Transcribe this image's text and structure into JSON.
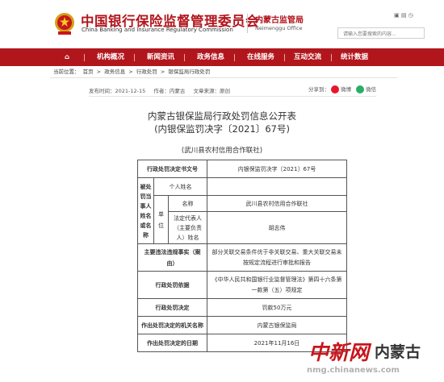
{
  "header": {
    "title_cn": "中国银行保险监督管理委员会",
    "title_en": "China Banking and Insurance Regulatory Commission",
    "branch_cn": "内蒙古监管局",
    "branch_en": "Neimenggu Office",
    "top_links": "▣ ▤ ◷",
    "search_placeholder": "请输入您要搜索的内容...",
    "search_icon": "search-icon"
  },
  "nav": {
    "items": [
      "首页",
      "机构概况",
      "新闻资讯",
      "政务信息",
      "在线服务",
      "互动交流",
      "统计数据"
    ]
  },
  "breadcrumb": {
    "label": "当前位置：",
    "items": [
      "首页",
      ">",
      "政务信息",
      ">",
      "行政处罚",
      ">",
      "银保监局行政处罚"
    ]
  },
  "meta": {
    "date": "发布时间：2021-12-15",
    "author": "作者：内蒙古",
    "source": "文章来源：原创",
    "share": [
      "分享到：",
      "微博",
      "微信"
    ]
  },
  "document": {
    "title_line1": "内蒙古银保监局行政处罚信息公开表",
    "title_line2": "(内银保监罚决字〔2021〕67号)",
    "org": "(武川县农村信用合作联社)"
  },
  "table": {
    "decision_no_label": "行政处罚决定书文号",
    "decision_no_value": "内银保监罚决字〔2021〕67号",
    "party_label": "被处罚当事人姓名或名称",
    "person_label": "个人姓名",
    "person_value": "",
    "unit_label": "单位",
    "name_label": "名称",
    "name_value": "武川县农村信用合作联社",
    "legal_rep_label": "法定代表人（主要负责人）姓名",
    "legal_rep_value": "胡志伟",
    "violation_label": "主要违法违规事实（案由）",
    "violation_value": "部分关联交易条件优于非关联交易、重大关联交易未按规定流程进行审批和报告",
    "basis_label": "行政处罚依据",
    "basis_value": "《中华人民共和国银行业监督管理法》第四十六条第一款第（五）项规定",
    "decision_label": "行政处罚决定",
    "decision_value": "罚款50万元",
    "authority_label": "作出处罚决定的机关名称",
    "authority_value": "内蒙古银保监局",
    "date_label": "作出处罚决定的日期",
    "date_value": "2021年11月16日"
  },
  "watermark": {
    "logo": "中新网",
    "city": "内蒙古",
    "url": "nmg.chinanews.com"
  },
  "colors": {
    "brand_red": "#b2161d",
    "nav_bg": "#b2161d"
  }
}
